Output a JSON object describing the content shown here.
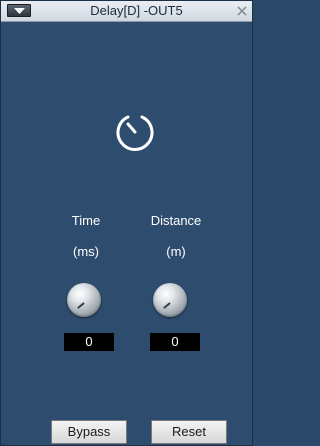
{
  "window": {
    "title": "Delay[D] -OUT5"
  },
  "controls": {
    "time": {
      "label": "Time",
      "unit": "(ms)",
      "value": "0"
    },
    "distance": {
      "label": "Distance",
      "unit": "(m)",
      "value": "0"
    }
  },
  "buttons": {
    "bypass": "Bypass",
    "reset": "Reset"
  },
  "icons": {
    "menu": "dropdown-arrow-icon",
    "close": "close-icon",
    "timer": "timer-icon"
  },
  "colors": {
    "background": "#2e4d6e",
    "value_box": "#000000",
    "text": "#ffffff"
  }
}
